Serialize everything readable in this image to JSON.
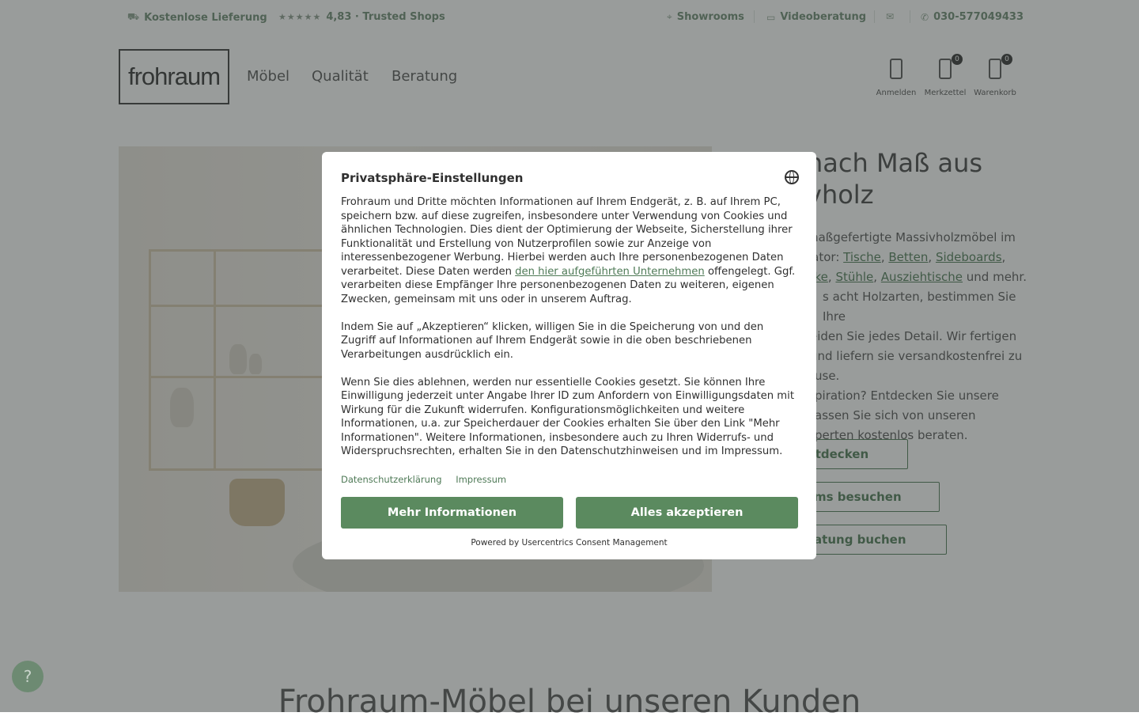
{
  "topbar": {
    "delivery": "Kostenlose Lieferung",
    "stars": "★★★★★",
    "rating": "4,83 · Trusted Shops",
    "showrooms": "Showrooms",
    "video": "Videoberatung",
    "phone": "030-577049433"
  },
  "header": {
    "logo": "frohraum",
    "nav": [
      "Möbel",
      "Qualität",
      "Beratung"
    ],
    "login_label": "Anmelden",
    "wishlist_label": "Merkzettel",
    "wishlist_count": "0",
    "cart_label": "Warenkorb",
    "cart_count": "0"
  },
  "hero": {
    "title_line1": "nach Maß aus",
    "title_line2": "vholz",
    "p1_a": "maßgefertigte Massivholzmöbel im",
    "p1_b": "rator: ",
    "links": [
      "Tische",
      "Betten",
      "Sideboards",
      "nke",
      "Stühle",
      "Ausziehtische"
    ],
    "p1_c": " und mehr.",
    "p1_d": "s acht Holzarten, bestimmen Sie Ihre",
    "p1_e": "eiden Sie jedes Detail. Wir fertigen",
    "p1_f": " und liefern sie versandkostenfrei zu",
    "p1_g": "use.",
    "p2_a": "piration? Entdecken Sie unsere",
    "p2_b": "assen Sie sich von unseren",
    "p2_c": "perten kostenlos beraten.",
    "cta1": "entdecken",
    "cta2": "ooms besuchen",
    "cta3": "eratung buchen"
  },
  "section": {
    "title": "Frohraum-Möbel bei unseren Kunden"
  },
  "help": {
    "label": "?"
  },
  "consent": {
    "title": "Privatsphäre-Einstellungen",
    "p1_start": "Frohraum und Dritte möchten Informationen auf Ihrem Endgerät, z. B. auf Ihrem PC, speichern bzw. auf diese zugreifen, insbesondere unter Verwendung von Cookies und ähnlichen Technologien. Dies dient der Optimierung der Webseite, Sicherstellung ihrer Funktionalität und Erstellung von Nutzerprofilen sowie zur Anzeige von interessenbezogener Werbung. Hierbei werden auch Ihre personenbezogenen Daten verarbeitet. Diese Daten werden ",
    "p1_link": "den hier aufgeführten Unternehmen",
    "p1_end": " offengelegt. Ggf. verarbeiten diese Empfänger Ihre personenbezogenen Daten zu weiteren, eigenen Zwecken, gemeinsam mit uns oder in unserem Auftrag.",
    "p2": "Indem Sie auf „Akzeptieren“ klicken, willigen Sie in die Speicherung von und den Zugriff auf Informationen auf Ihrem Endgerät sowie in die oben beschriebenen Verarbeitungen ausdrücklich ein.",
    "p3": "Wenn Sie dies ablehnen, werden nur essentielle Cookies gesetzt. Sie können Ihre Einwilligung jederzeit unter Angabe Ihrer ID zum Anfordern von Einwilligungsdaten mit Wirkung für die Zukunft widerrufen. Konfigurationsmöglichkeiten und weitere Informationen, u.a. zur Speicherdauer der Cookies erhalten Sie über den Link \"Mehr Informationen\". Weitere Informationen, insbesondere auch zu Ihren Widerrufs- und Widerspruchsrechten, erhalten Sie in den Datenschutzhinweisen und im Impressum.",
    "link_privacy": "Datenschutzerklärung",
    "link_imprint": "Impressum",
    "btn_more": "Mehr Informationen",
    "btn_accept": "Alles akzeptieren",
    "powered": "Powered by Usercentrics Consent Management"
  }
}
